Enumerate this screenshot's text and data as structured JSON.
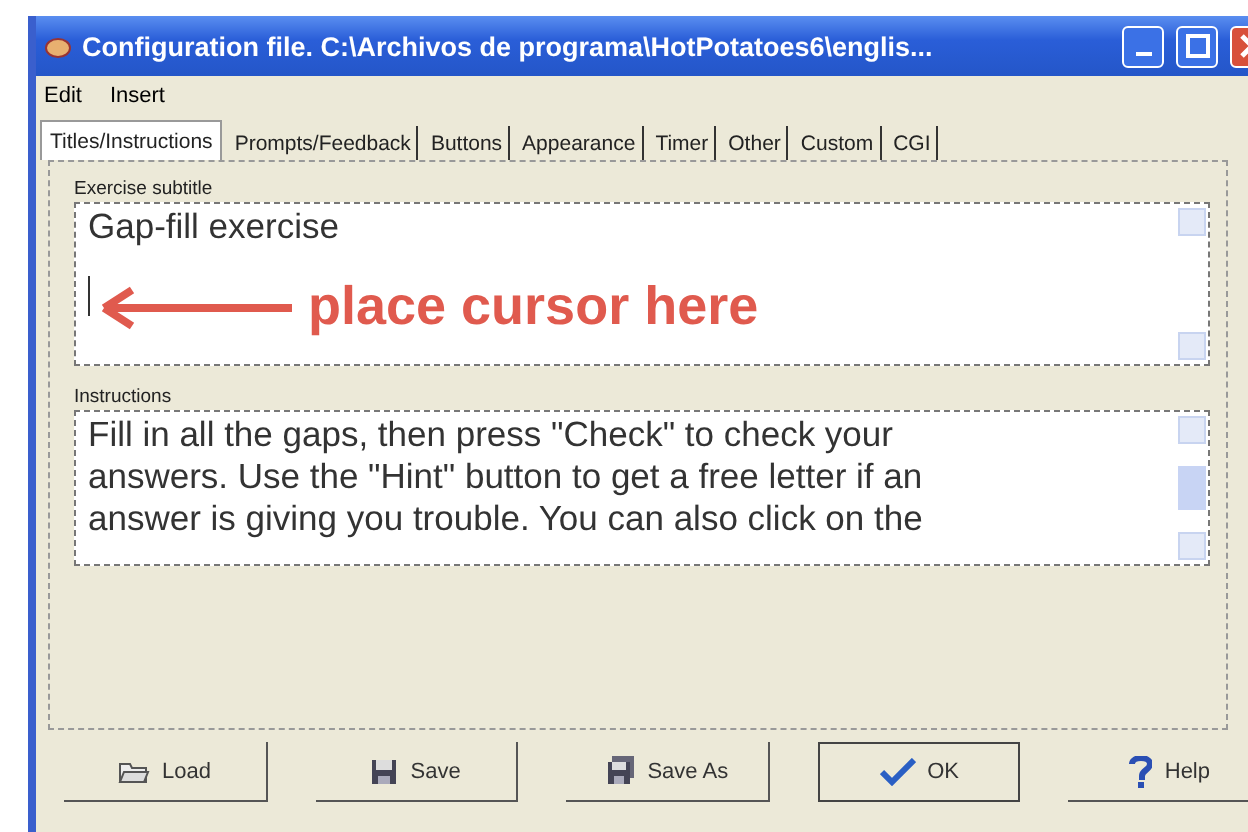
{
  "window": {
    "title": "Configuration file. C:\\Archivos de programa\\HotPotatoes6\\englis..."
  },
  "menu": [
    "Edit",
    "Insert"
  ],
  "tabs": [
    {
      "label": "Titles/Instructions",
      "selected": true
    },
    {
      "label": "Prompts/Feedback",
      "selected": false
    },
    {
      "label": "Buttons",
      "selected": false
    },
    {
      "label": "Appearance",
      "selected": false
    },
    {
      "label": "Timer",
      "selected": false
    },
    {
      "label": "Other",
      "selected": false
    },
    {
      "label": "Custom",
      "selected": false
    },
    {
      "label": "CGI",
      "selected": false
    }
  ],
  "subtitle": {
    "label": "Exercise subtitle",
    "value": "Gap-fill exercise"
  },
  "annotation": {
    "text": "place cursor here"
  },
  "instructions": {
    "label": "Instructions",
    "lines": [
      "Fill in all the gaps, then press \"Check\" to check your",
      "answers. Use the \"Hint\" button to get a free letter if an",
      "answer is giving you trouble. You can also click on the"
    ]
  },
  "buttons": [
    {
      "label": "Load",
      "kind": "load"
    },
    {
      "label": "Save",
      "kind": "save"
    },
    {
      "label": "Save As",
      "kind": "saveas"
    },
    {
      "label": "OK",
      "kind": "ok"
    },
    {
      "label": "Help",
      "kind": "help"
    }
  ]
}
